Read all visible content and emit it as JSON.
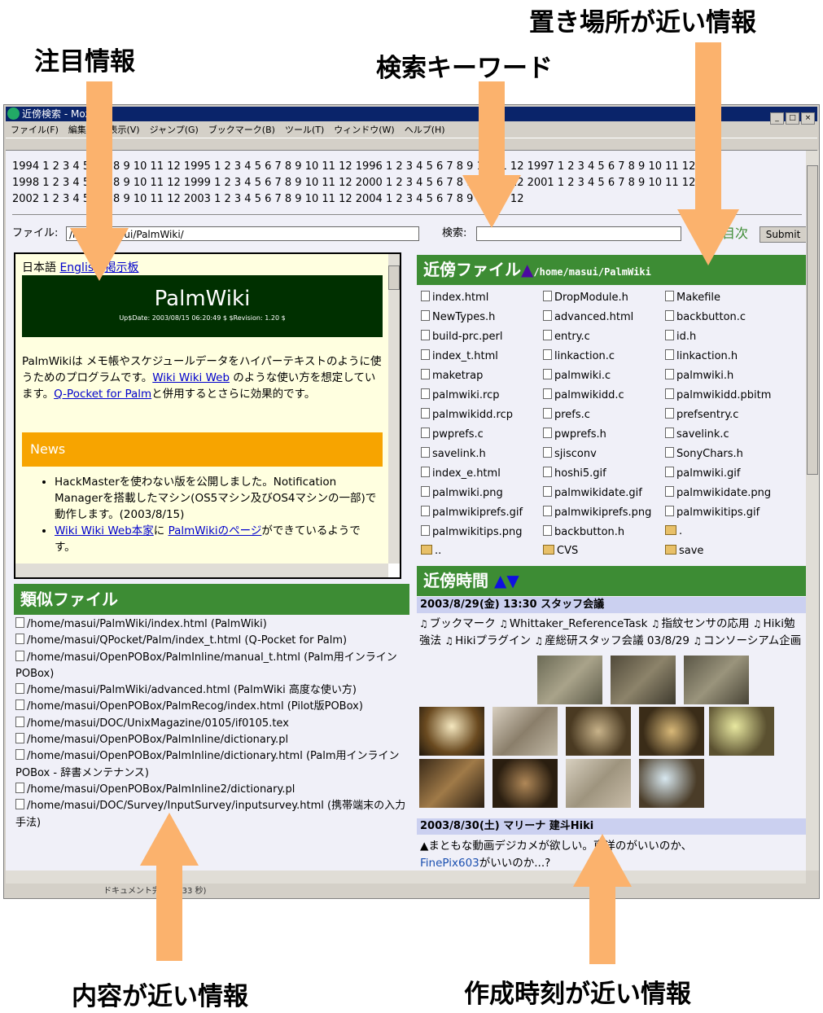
{
  "callouts": {
    "attention": "注目情報",
    "search_keyword": "検索キーワード",
    "nearby_location": "置き場所が近い情報",
    "similar_content": "内容が近い情報",
    "nearby_time": "作成時刻が近い情報"
  },
  "window": {
    "title": "近傍検索 - Mozilla",
    "menus": [
      "ファイル(F)",
      "編集(E)",
      "表示(V)",
      "ジャンプ(G)",
      "ブックマーク(B)",
      "ツール(T)",
      "ウィンドウ(W)",
      "ヘルプ(H)"
    ],
    "status_text": "ドキュメント完了 (0.33 秒)"
  },
  "calendar": {
    "lines": [
      "1994 1 2 3 4 5 6 7 8 9 10 11 12   1995 1 2 3 4 5 6 7 8 9 10 11 12   1996 1 2 3 4 5 6 7 8 9 10 11 12   1997 1 2 3 4 5 6 7 8 9 10 11 12",
      "1998 1 2 3 4 5 6 7 8 9 10 11 12   1999 1 2 3 4 5 6 7 8 9 10 11 12   2000 1 2 3 4 5 6 7 8 9 10 11 12   2001 1 2 3 4 5 6 7 8 9 10 11 12",
      "2002 1 2 3 4 5 6 7 8 9 10 11 12   2003 1 2 3 4 5 6 7 8 9 10 11 12   2004 1 2 3 4 5 6 7 8 9 10 11 12"
    ]
  },
  "search": {
    "file_label": "ファイル:",
    "file_value": "/home/masui/PalmWiki/",
    "search_label": "検索:",
    "search_value": "",
    "prev_label": "前",
    "next_label": "次",
    "prev_glyph": "◀",
    "nav_glyph": "目",
    "submit": "Submit"
  },
  "palm": {
    "links": [
      "日本語",
      "English",
      "掲示板"
    ],
    "title": "PalmWiki",
    "date_line": "Up$Date: 2003/08/15 06:20:49 $ $Revision: 1.20 $",
    "para1_a": "PalmWikiは メモ帳やスケジュールデータをハイパーテキストのように使うためのプログラムです。",
    "para1_link1": "Wiki Wiki Web",
    "para1_b": " のような使い方を想定しています。",
    "para1_link2": "Q-Pocket for Palm",
    "para1_c": "と併用するとさらに効果的です。",
    "news_title": "News",
    "news1": "HackMasterを使わない版を公開しました。Notification Managerを搭載したマシン(OS5マシン及びOS4マシンの一部)で動作します。(2003/8/15)",
    "news2_link1": "Wiki Wiki Web本家",
    "news2_mid": "に ",
    "news2_link2": "PalmWikiのページ",
    "news2_end": "ができているようです。"
  },
  "nearby_files": {
    "header": "近傍ファイル",
    "path": "/home/masui/PalmWiki",
    "up_arrow": "▲",
    "items": [
      {
        "name": "index.html",
        "type": "file"
      },
      {
        "name": "DropModule.h",
        "type": "file"
      },
      {
        "name": "Makefile",
        "type": "file"
      },
      {
        "name": "NewTypes.h",
        "type": "file"
      },
      {
        "name": "advanced.html",
        "type": "file"
      },
      {
        "name": "backbutton.c",
        "type": "file"
      },
      {
        "name": "build-prc.perl",
        "type": "file"
      },
      {
        "name": "entry.c",
        "type": "file"
      },
      {
        "name": "id.h",
        "type": "file"
      },
      {
        "name": "index_t.html",
        "type": "file"
      },
      {
        "name": "linkaction.c",
        "type": "file"
      },
      {
        "name": "linkaction.h",
        "type": "file"
      },
      {
        "name": "maketrap",
        "type": "file"
      },
      {
        "name": "palmwiki.c",
        "type": "file"
      },
      {
        "name": "palmwiki.h",
        "type": "file"
      },
      {
        "name": "palmwiki.rcp",
        "type": "file"
      },
      {
        "name": "palmwikidd.c",
        "type": "file"
      },
      {
        "name": "palmwikidd.pbitm",
        "type": "file"
      },
      {
        "name": "palmwikidd.rcp",
        "type": "file"
      },
      {
        "name": "prefs.c",
        "type": "file"
      },
      {
        "name": "prefsentry.c",
        "type": "file"
      },
      {
        "name": "pwprefs.c",
        "type": "file"
      },
      {
        "name": "pwprefs.h",
        "type": "file"
      },
      {
        "name": "savelink.c",
        "type": "file"
      },
      {
        "name": "savelink.h",
        "type": "file"
      },
      {
        "name": "sjisconv",
        "type": "file"
      },
      {
        "name": "SonyChars.h",
        "type": "file"
      },
      {
        "name": "index_e.html",
        "type": "file"
      },
      {
        "name": "hoshi5.gif",
        "type": "file"
      },
      {
        "name": "palmwiki.gif",
        "type": "file"
      },
      {
        "name": "palmwiki.png",
        "type": "file"
      },
      {
        "name": "palmwikidate.gif",
        "type": "file"
      },
      {
        "name": "palmwikidate.png",
        "type": "file"
      },
      {
        "name": "palmwikiprefs.gif",
        "type": "file"
      },
      {
        "name": "palmwikiprefs.png",
        "type": "file"
      },
      {
        "name": "palmwikitips.gif",
        "type": "file"
      },
      {
        "name": "palmwikitips.png",
        "type": "file"
      },
      {
        "name": "backbutton.h",
        "type": "file"
      },
      {
        "name": ".",
        "type": "folder"
      },
      {
        "name": "..",
        "type": "folder"
      },
      {
        "name": "CVS",
        "type": "folder"
      },
      {
        "name": "save",
        "type": "folder"
      }
    ]
  },
  "similar_files": {
    "header": "類似ファイル",
    "items": [
      "/home/masui/PalmWiki/index.html (PalmWiki)",
      "/home/masui/QPocket/Palm/index_t.html (Q-Pocket for Palm)",
      "/home/masui/OpenPOBox/PalmInline/manual_t.html (Palm用インラインPOBox)",
      "/home/masui/PalmWiki/advanced.html (PalmWiki 高度な使い方)",
      "/home/masui/OpenPOBox/PalmRecog/index.html (Pilot版POBox)",
      "/home/masui/DOC/UnixMagazine/0105/if0105.tex",
      "/home/masui/OpenPOBox/PalmInline/dictionary.pl",
      "/home/masui/OpenPOBox/PalmInline/dictionary.html (Palm用インラインPOBox - 辞書メンテナンス)",
      "/home/masui/OpenPOBox/PalmInline2/dictionary.pl",
      "/home/masui/DOC/Survey/InputSurvey/inputsurvey.html (携帯端末の入力手法)"
    ]
  },
  "nearby_time": {
    "header": "近傍時間",
    "arrows": "▲▼",
    "date1": "2003/8/29(金) 13:30 スタッフ会議",
    "links1": [
      "ブックマーク",
      "Whittaker_ReferenceTask",
      "指紋センサの応用",
      "Hiki勉強法",
      "Hikiプラグイン",
      "産総研スタッフ会議 03/8/29",
      "コンソーシアム企画"
    ],
    "date2": "2003/8/30(土) マリーナ 建斗Hiki",
    "text2_a": "▲まともな動画デジカメが欲しい。東洋のがいいのか、",
    "text2_link": "FinePix603",
    "text2_b": "がいいのか...?"
  },
  "colors": {
    "green_header": "#3d8c34",
    "callout_arrow": "#fbb26d",
    "palm_dark": "#003000",
    "news_orange": "#f7a400"
  }
}
